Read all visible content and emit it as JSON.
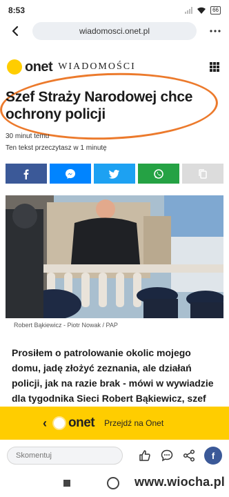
{
  "status_bar": {
    "time": "8:53",
    "battery": "66"
  },
  "browser": {
    "url": "wiadomosci.onet.pl"
  },
  "header": {
    "logo": "onet",
    "section": "WIADOMOŚCI"
  },
  "article": {
    "headline": "Szef Straży Narodowej chce ochrony policji",
    "time_ago": "30 minut temu",
    "read_time": "Ten tekst przeczytasz w 1 minutę",
    "photo_caption": "Robert Bąkiewicz - Piotr Nowak / PAP",
    "lead": "Prosiłem o patrolowanie okolic mojego domu, jadę złożyć zeznania, ale działań policji, jak na razie brak - mówi w wywiadzie dla tygodnika Sieci Robert Bąkiewicz, szef"
  },
  "share": {
    "colors": {
      "facebook": "#3b5998",
      "messenger": "#0084ff",
      "twitter": "#1da1f2",
      "whatsapp": "#25a244",
      "copy": "#dcdcdc"
    }
  },
  "banner": {
    "logo": "onet",
    "cta": "Przejdź na Onet",
    "color": "#ffcd00"
  },
  "toolbar": {
    "comment_placeholder": "Skomentuj",
    "facebook_label": "f"
  },
  "watermark": "www.wiocha.pl",
  "accent": "#ec7a2c"
}
